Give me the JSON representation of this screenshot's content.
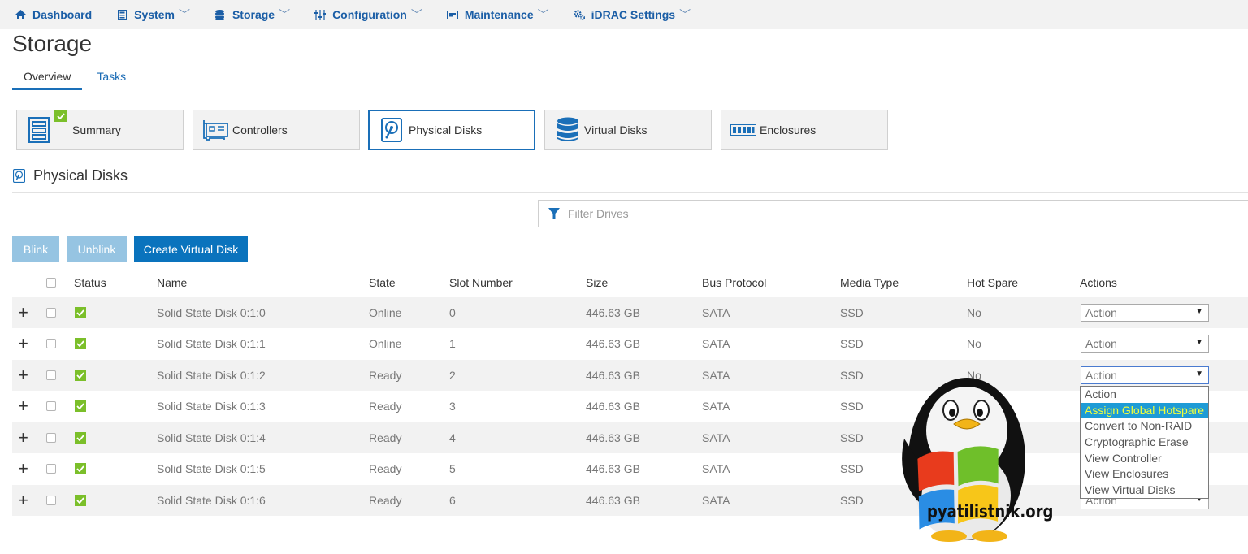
{
  "nav": {
    "items": [
      {
        "label": "Dashboard",
        "icon": "home-icon",
        "chevron": false
      },
      {
        "label": "System",
        "icon": "server-icon",
        "chevron": true
      },
      {
        "label": "Storage",
        "icon": "database-icon",
        "chevron": true
      },
      {
        "label": "Configuration",
        "icon": "sliders-icon",
        "chevron": true
      },
      {
        "label": "Maintenance",
        "icon": "monitor-icon",
        "chevron": true
      },
      {
        "label": "iDRAC Settings",
        "icon": "gears-icon",
        "chevron": true
      }
    ]
  },
  "page": {
    "title": "Storage",
    "tabs": [
      {
        "label": "Overview",
        "active": true
      },
      {
        "label": "Tasks",
        "active": false
      }
    ]
  },
  "tiles": [
    {
      "label": "Summary",
      "icon": "summary-icon",
      "status_badge": "check-badge",
      "active": false
    },
    {
      "label": "Controllers",
      "icon": "controller-card-icon",
      "active": false
    },
    {
      "label": "Physical Disks",
      "icon": "hard-disk-icon",
      "active": true
    },
    {
      "label": "Virtual Disks",
      "icon": "database-stack-icon",
      "active": false
    },
    {
      "label": "Enclosures",
      "icon": "enclosure-icon",
      "active": false
    }
  ],
  "section": {
    "title": "Physical Disks",
    "filter_placeholder": "Filter Drives"
  },
  "buttons": {
    "blink": "Blink",
    "unblink": "Unblink",
    "create_vd": "Create Virtual Disk"
  },
  "table": {
    "headers": [
      "Status",
      "Name",
      "State",
      "Slot Number",
      "Size",
      "Bus Protocol",
      "Media Type",
      "Hot Spare",
      "Actions"
    ],
    "rows": [
      {
        "name": "Solid State Disk 0:1:0",
        "state": "Online",
        "slot": "0",
        "size": "446.63 GB",
        "bus": "SATA",
        "media": "SSD",
        "hot_spare": "No",
        "action": "Action"
      },
      {
        "name": "Solid State Disk 0:1:1",
        "state": "Online",
        "slot": "1",
        "size": "446.63 GB",
        "bus": "SATA",
        "media": "SSD",
        "hot_spare": "No",
        "action": "Action"
      },
      {
        "name": "Solid State Disk 0:1:2",
        "state": "Ready",
        "slot": "2",
        "size": "446.63 GB",
        "bus": "SATA",
        "media": "SSD",
        "hot_spare": "No",
        "action": "Action"
      },
      {
        "name": "Solid State Disk 0:1:3",
        "state": "Ready",
        "slot": "3",
        "size": "446.63 GB",
        "bus": "SATA",
        "media": "SSD",
        "hot_spare": "",
        "action": ""
      },
      {
        "name": "Solid State Disk 0:1:4",
        "state": "Ready",
        "slot": "4",
        "size": "446.63 GB",
        "bus": "SATA",
        "media": "SSD",
        "hot_spare": "",
        "action": ""
      },
      {
        "name": "Solid State Disk 0:1:5",
        "state": "Ready",
        "slot": "5",
        "size": "446.63 GB",
        "bus": "SATA",
        "media": "SSD",
        "hot_spare": "",
        "action": ""
      },
      {
        "name": "Solid State Disk 0:1:6",
        "state": "Ready",
        "slot": "6",
        "size": "446.63 GB",
        "bus": "SATA",
        "media": "SSD",
        "hot_spare": "",
        "action": "Action"
      }
    ]
  },
  "dropdown": {
    "options": [
      "Action",
      "Assign Global Hotspare",
      "Convert to Non-RAID",
      "Cryptographic Erase",
      "View Controller",
      "View Enclosures",
      "View Virtual Disks"
    ],
    "highlighted": "Assign Global Hotspare"
  },
  "watermark": {
    "text": "pyatilistnik.org"
  },
  "colors": {
    "accent": "#0a73bd",
    "nav_text": "#1b5ea6",
    "status_ok": "#7bbf2a",
    "disabled_button": "#96c4e2",
    "highlight": "#1e9bd6"
  }
}
